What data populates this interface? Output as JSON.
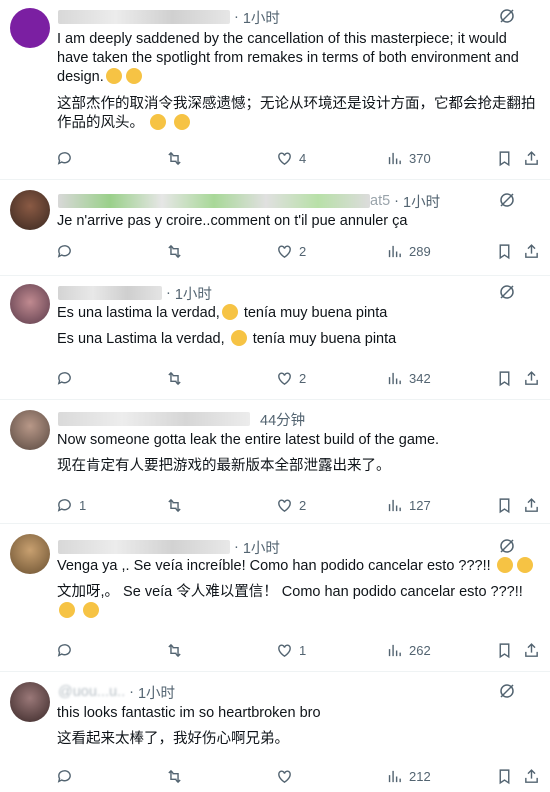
{
  "posts": [
    {
      "time": "1小时",
      "paragraphs": [
        "I am deeply saddened by the cancellation of this masterpiece; it would have taken the spotlight from remakes in terms of both environment and design.",
        "这部杰作的取消令我深感遗憾；无论从环境还是设计方面，它都会抢走翻拍作品的风头。"
      ],
      "replies": "",
      "likes": "4",
      "views": "370"
    },
    {
      "name_suffix": "at5",
      "time": "1小时",
      "paragraphs": [
        "Je n'arrive pas y croire..comment on t'il pue annuler ça"
      ],
      "replies": "",
      "likes": "2",
      "views": "289"
    },
    {
      "time": "1小时",
      "paragraphs": [
        "Es una lastima la verdad,",
        "Es una Lastima la verdad,"
      ],
      "para_tail": "tenía muy buena pinta",
      "replies": "",
      "likes": "2",
      "views": "342"
    },
    {
      "time": "44分钟",
      "paragraphs": [
        "Now someone gotta leak the entire latest build of the game.",
        "现在肯定有人要把游戏的最新版本全部泄露出来了。"
      ],
      "replies": "1",
      "likes": "2",
      "views": "127"
    },
    {
      "time": "1小时",
      "paragraphs": [
        "Venga ya ,. Se veía increíble! Como han podido cancelar esto ???!!",
        "文加呀,。 Se veía 令人难以置信！ Como han podido cancelar esto ???!!"
      ],
      "replies": "",
      "likes": "1",
      "views": "262"
    },
    {
      "name_handle": "@uou...u..",
      "time": "1小时",
      "paragraphs": [
        "this looks fantastic im so heartbroken bro",
        "这看起来太棒了，我好伤心啊兄弟。"
      ],
      "replies": "",
      "likes": "",
      "views": "212"
    }
  ],
  "colors": {
    "text": "#0f1419",
    "muted": "#536471",
    "divider": "#eff3f4",
    "emoji": "#f6c344"
  },
  "icons": [
    "grok-icon",
    "reply-icon",
    "retweet-icon",
    "like-icon",
    "views-icon",
    "bookmark-icon",
    "share-icon",
    "pensive-emoji",
    "sob-emoji"
  ]
}
